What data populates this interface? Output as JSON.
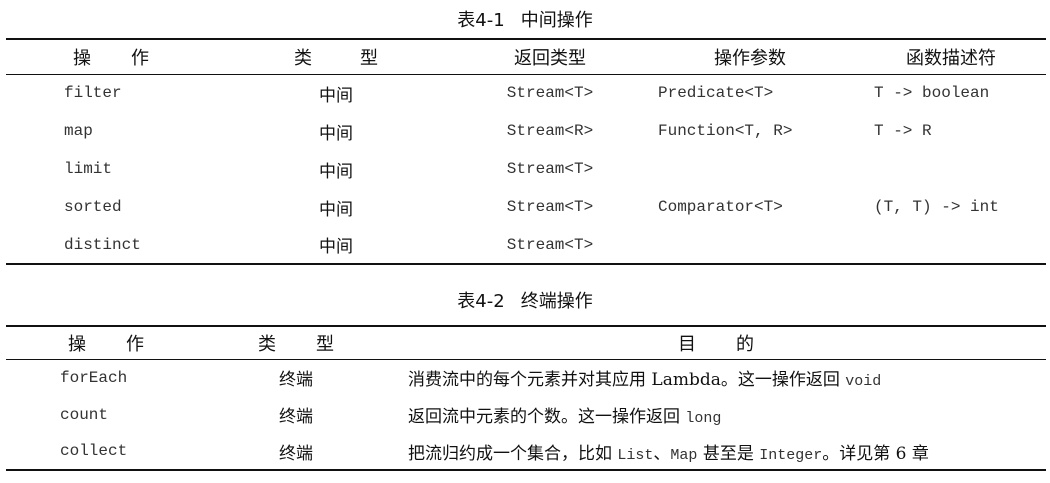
{
  "table1": {
    "caption_num": "表4-1",
    "caption_title": "中间操作",
    "headers": {
      "op_a": "操",
      "op_b": "作",
      "type_a": "类",
      "type_b": "型",
      "ret": "返回类型",
      "param": "操作参数",
      "desc": "函数描述符"
    },
    "rows": [
      {
        "op": "filter",
        "type": "中间",
        "ret": "Stream<T>",
        "param": "Predicate<T>",
        "desc": "T -> boolean"
      },
      {
        "op": "map",
        "type": "中间",
        "ret": "Stream<R>",
        "param": "Function<T, R>",
        "desc": "T -> R"
      },
      {
        "op": "limit",
        "type": "中间",
        "ret": "Stream<T>",
        "param": "",
        "desc": ""
      },
      {
        "op": "sorted",
        "type": "中间",
        "ret": "Stream<T>",
        "param": "Comparator<T>",
        "desc": "(T, T) -> int"
      },
      {
        "op": "distinct",
        "type": "中间",
        "ret": "Stream<T>",
        "param": "",
        "desc": ""
      }
    ]
  },
  "table2": {
    "caption_num": "表4-2",
    "caption_title": "终端操作",
    "headers": {
      "op_a": "操",
      "op_b": "作",
      "type_a": "类",
      "type_b": "型",
      "purpose_a": "目",
      "purpose_b": "的"
    },
    "rows": [
      {
        "op": "forEach",
        "type": "终端",
        "p1": "消费流中的每个元素并对其应用 Lambda。这一操作返回 ",
        "p1code": "void"
      },
      {
        "op": "count",
        "type": "终端",
        "p1": "返回流中元素的个数。这一操作返回 ",
        "p1code": "long"
      },
      {
        "op": "collect",
        "type": "终端",
        "p1": "把流归约成一个集合，比如 ",
        "c1": "List",
        "p2": "、",
        "c2": "Map",
        "p3": " 甚至是 ",
        "c3": "Integer",
        "p4": "。详见第 6 章"
      }
    ]
  }
}
